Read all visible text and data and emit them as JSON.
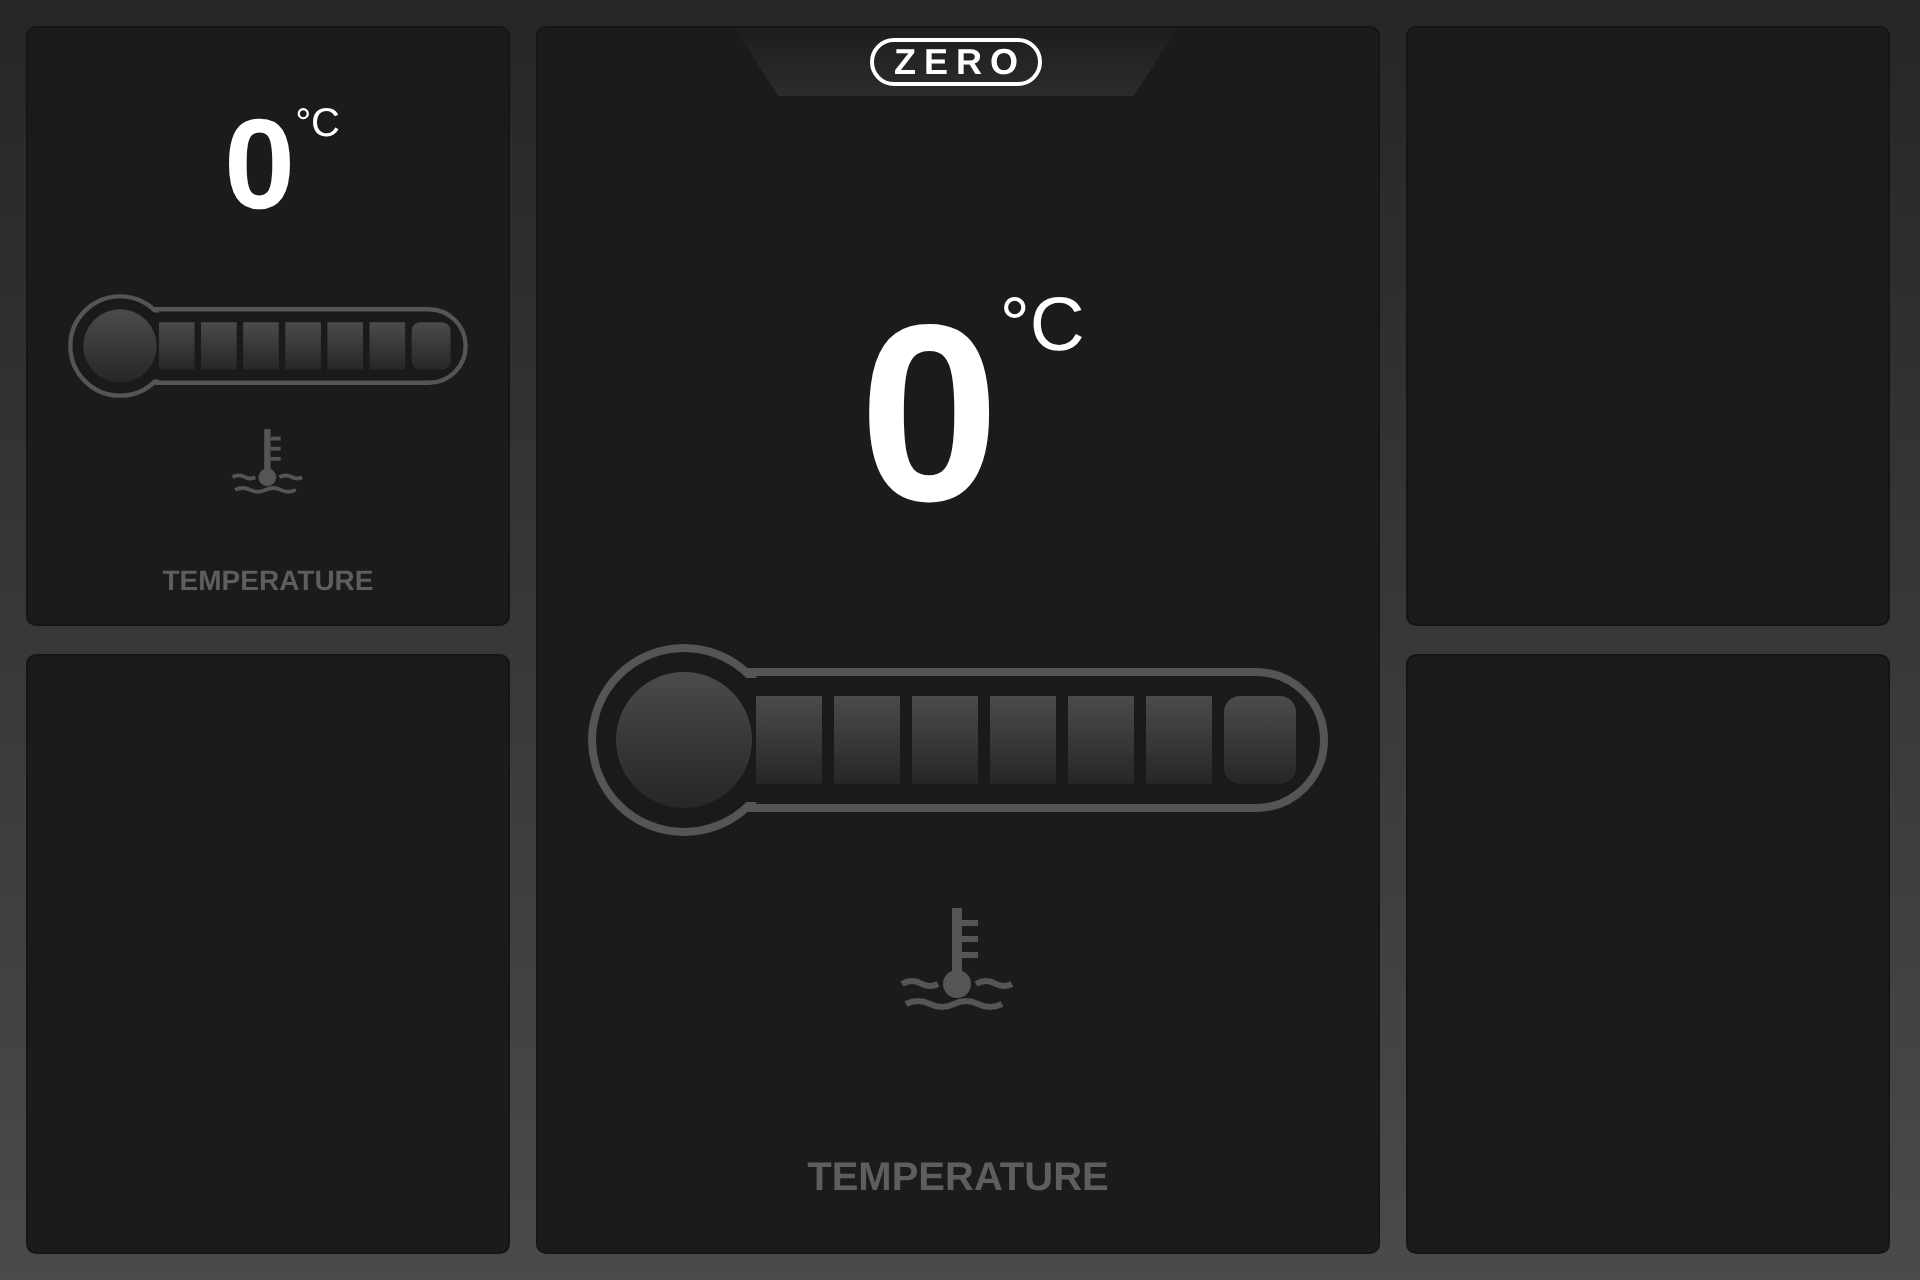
{
  "logo": "ZERO",
  "gauges": [
    {
      "value": "0",
      "unit": "°C",
      "label": "TEMPERATURE"
    },
    {
      "value": "0",
      "unit": "°C",
      "label": "TEMPERATURE"
    }
  ]
}
